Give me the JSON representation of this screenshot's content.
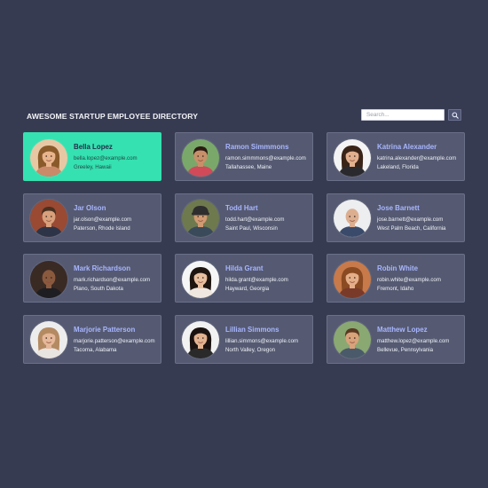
{
  "header": {
    "title": "AWESOME STARTUP EMPLOYEE DIRECTORY",
    "search_placeholder": "Search...",
    "search_icon": "magnifier-icon"
  },
  "colors": {
    "background": "#373b52",
    "card": "#555a72",
    "selected_card": "#35e1b0",
    "name_text": "#a8b6ff"
  },
  "employees": [
    {
      "name": "Bella Lopez",
      "email": "bella.lopez@example.com",
      "location": "Greeley, Hawaii",
      "selected": true,
      "avatar": {
        "bg": "#e8c8a4",
        "skin": "#e8b48c",
        "hair": "#8a5a2a",
        "shirt": "#c98a6a",
        "style": "long"
      }
    },
    {
      "name": "Ramon Simmmons",
      "email": "ramon.simmmons@example.com",
      "location": "Tallahassee, Maine",
      "selected": false,
      "avatar": {
        "bg": "#7aa86a",
        "skin": "#c8906a",
        "hair": "#2a1a12",
        "shirt": "#d04a5a",
        "style": "short"
      }
    },
    {
      "name": "Katrina Alexander",
      "email": "katrina.alexander@example.com",
      "location": "Lakeland, Florida",
      "selected": false,
      "avatar": {
        "bg": "#f4f4f4",
        "skin": "#e2b08e",
        "hair": "#3a2418",
        "shirt": "#2a2a2e",
        "style": "long"
      }
    },
    {
      "name": "Jar Olson",
      "email": "jar.olson@example.com",
      "location": "Paterson, Rhode Island",
      "selected": false,
      "avatar": {
        "bg": "#9a4a32",
        "skin": "#d8a07c",
        "hair": "#4a3020",
        "shirt": "#2e3448",
        "style": "short"
      }
    },
    {
      "name": "Todd Hart",
      "email": "todd.hart@example.com",
      "location": "Saint Paul, Wisconsin",
      "selected": false,
      "avatar": {
        "bg": "#6e7a4e",
        "skin": "#d09a72",
        "hair": "#2e2e2e",
        "shirt": "#3a4a5a",
        "style": "cap"
      }
    },
    {
      "name": "Jose Barnett",
      "email": "jose.barnett@example.com",
      "location": "West Palm Beach, California",
      "selected": false,
      "avatar": {
        "bg": "#eceef0",
        "skin": "#dcae90",
        "hair": "#c8a888",
        "shirt": "#3a4a6a",
        "style": "bald"
      }
    },
    {
      "name": "Mark Richardson",
      "email": "mark.richardson@example.com",
      "location": "Plano, South Dakota",
      "selected": false,
      "avatar": {
        "bg": "#3a2a24",
        "skin": "#8a5a3e",
        "hair": "#1a1210",
        "shirt": "#1e1e22",
        "style": "bald"
      }
    },
    {
      "name": "Hilda Grant",
      "email": "hilda.grant@example.com",
      "location": "Hayward, Georgia",
      "selected": false,
      "avatar": {
        "bg": "#f6f6f6",
        "skin": "#e8c0a0",
        "hair": "#1e1410",
        "shirt": "#f0e8e0",
        "style": "long"
      }
    },
    {
      "name": "Robin White",
      "email": "robin.white@example.com",
      "location": "Fremont, Idaho",
      "selected": false,
      "avatar": {
        "bg": "#c87a4a",
        "skin": "#e4ae88",
        "hair": "#8a4a22",
        "shirt": "#7a3a2a",
        "style": "long"
      }
    },
    {
      "name": "Marjorie Patterson",
      "email": "marjorie.patterson@example.com",
      "location": "Tacoma, Alabama",
      "selected": false,
      "avatar": {
        "bg": "#ededed",
        "skin": "#e6b89a",
        "hair": "#b48a62",
        "shirt": "#e8e4e0",
        "style": "long"
      }
    },
    {
      "name": "Lillian Simmons",
      "email": "lillian.simmons@example.com",
      "location": "North Valley, Oregon",
      "selected": false,
      "avatar": {
        "bg": "#f2f2f2",
        "skin": "#e2b290",
        "hair": "#1a1210",
        "shirt": "#2a2a2a",
        "style": "long"
      }
    },
    {
      "name": "Matthew Lopez",
      "email": "matthew.lopez@example.com",
      "location": "Bellevue, Pennsylvania",
      "selected": false,
      "avatar": {
        "bg": "#8aa872",
        "skin": "#d8a27a",
        "hair": "#5a3a22",
        "shirt": "#4a5a6a",
        "style": "short"
      }
    }
  ]
}
